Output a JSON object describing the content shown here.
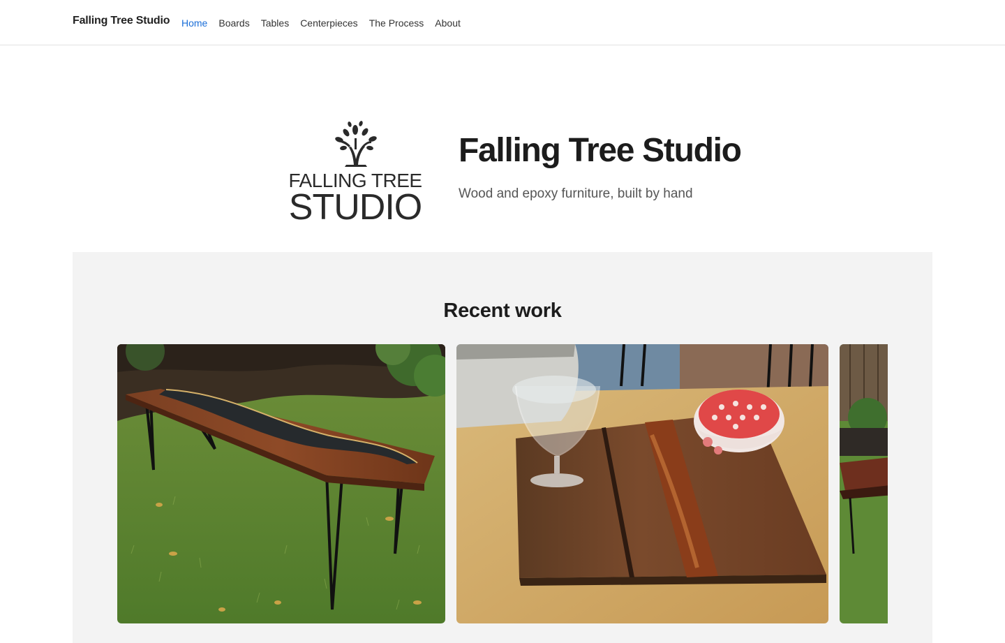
{
  "navbar": {
    "brand": "Falling Tree Studio",
    "links": [
      {
        "label": "Home",
        "active": true
      },
      {
        "label": "Boards",
        "active": false
      },
      {
        "label": "Tables",
        "active": false
      },
      {
        "label": "Centerpieces",
        "active": false
      },
      {
        "label": "The Process",
        "active": false
      },
      {
        "label": "About",
        "active": false
      }
    ]
  },
  "hero": {
    "logo_text_line1": "FALLING TREE",
    "logo_text_line2": "STUDIO",
    "title": "Falling Tree Studio",
    "subtitle": "Wood and epoxy furniture, built by hand"
  },
  "recent": {
    "heading": "Recent work",
    "items": [
      {
        "image": "walnut-epoxy-river-table-on-hairpin-legs"
      },
      {
        "image": "walnut-epoxy-serving-board-with-glass-and-bowl"
      },
      {
        "image": "walnut-table-partial"
      }
    ]
  },
  "colors": {
    "accent": "#1a6ed8",
    "section_bg": "#f3f3f3",
    "text": "#1c1c1c"
  }
}
